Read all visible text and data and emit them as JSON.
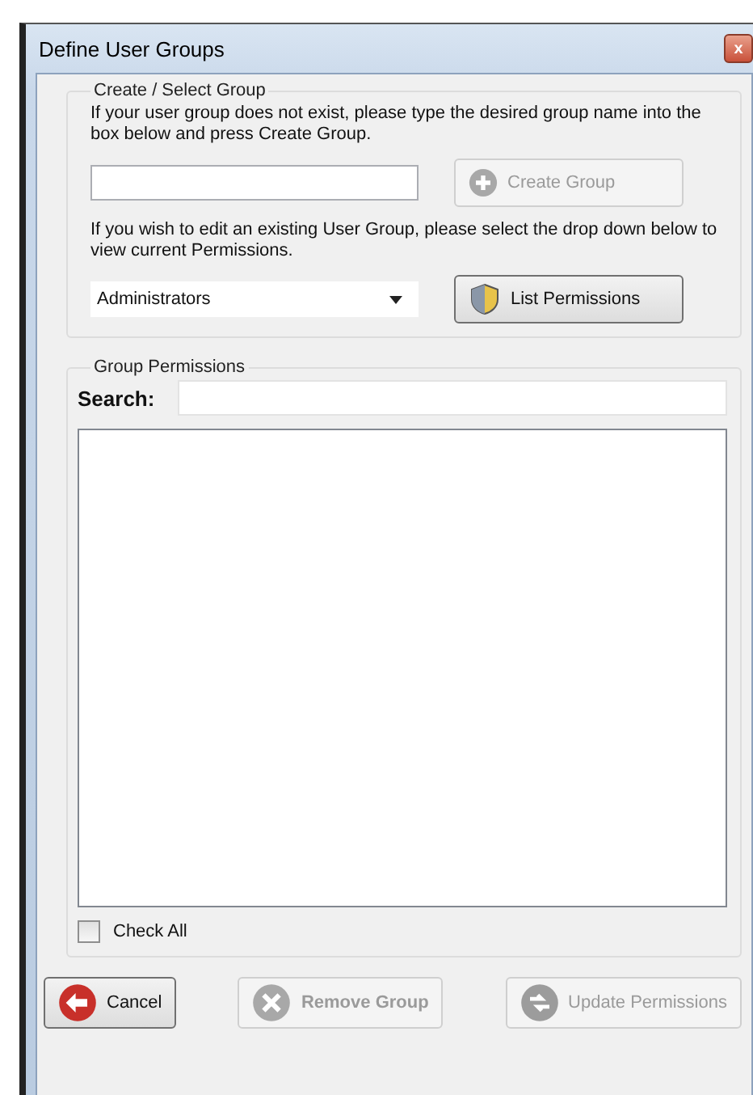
{
  "window": {
    "title": "Define User Groups",
    "close_label": "x"
  },
  "create_select": {
    "legend": "Create / Select Group",
    "instructions": "If your user group does not exist, please type the desired group name into the box below and press Create Group.",
    "create_button": {
      "label": "Create Group",
      "disabled": true
    },
    "edit_instructions": "If you wish to edit an existing User Group, please select the drop down below to view current Permissions.",
    "group_select": {
      "value": "Administrators"
    },
    "list_button": {
      "label": "List Permissions",
      "disabled": false
    }
  },
  "group_permissions": {
    "legend": "Group Permissions",
    "search_label": "Search:",
    "check_all": {
      "label": "Check All",
      "checked": false
    }
  },
  "buttons": [
    {
      "kind": "cancel",
      "label": "Cancel",
      "disabled": false,
      "bold": false
    },
    {
      "kind": "remove",
      "label": "Remove Group",
      "disabled": true,
      "bold": true
    },
    {
      "kind": "update",
      "label": "Update Permissions",
      "disabled": true,
      "bold": false
    }
  ]
}
